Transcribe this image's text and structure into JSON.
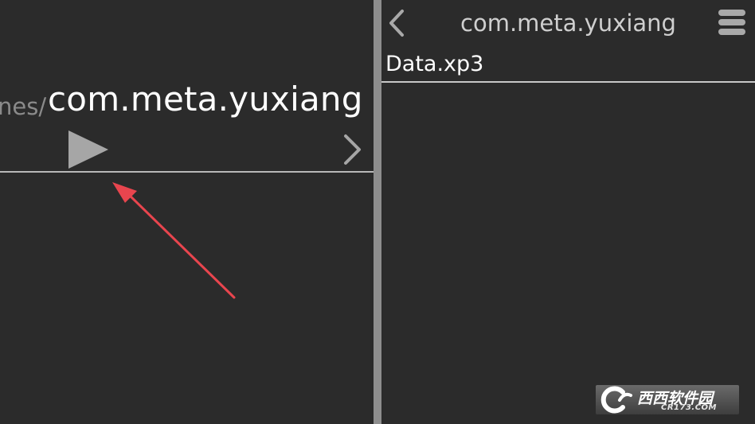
{
  "left_pane": {
    "path_prefix": "nes/",
    "path_current": "com.meta.yuxiang",
    "play_icon": "play-triangle-icon",
    "next_icon": "chevron-right-icon"
  },
  "annotation": {
    "arrow_color": "#e8454e",
    "icon": "red-arrow-annotation"
  },
  "right_pane": {
    "back_icon": "chevron-left-icon",
    "title": "com.meta.yuxiang",
    "menu_icon": "menu-icon",
    "files": [
      {
        "name": "Data.xp3"
      }
    ]
  },
  "watermark": {
    "main": "西西软件园",
    "sub": "CR173.COM"
  },
  "colors": {
    "background": "#2b2b2b",
    "separator": "#8e8e8e",
    "text_primary": "#ffffff",
    "text_secondary": "#8a8a8a",
    "divider": "#c8c8c8"
  }
}
